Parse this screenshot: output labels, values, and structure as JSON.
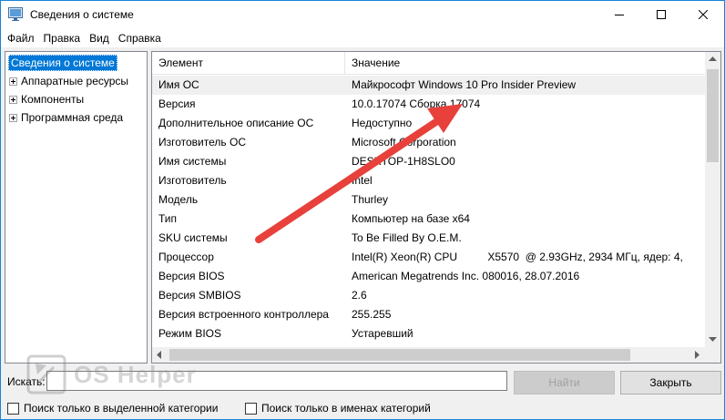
{
  "window": {
    "title": "Сведения о системе",
    "icon": "system-info-icon"
  },
  "menu": [
    "Файл",
    "Правка",
    "Вид",
    "Справка"
  ],
  "tree": {
    "root": "Сведения о системе",
    "children": [
      "Аппаратные ресурсы",
      "Компоненты",
      "Программная среда"
    ]
  },
  "table": {
    "columns": [
      "Элемент",
      "Значение"
    ],
    "rows": [
      [
        "Имя ОС",
        "Майкрософт Windows 10 Pro Insider Preview"
      ],
      [
        "Версия",
        "10.0.17074 Сборка 17074"
      ],
      [
        "Дополнительное описание ОС",
        "Недоступно"
      ],
      [
        "Изготовитель ОС",
        "Microsoft Corporation"
      ],
      [
        "Имя системы",
        "DESKTOP-1H8SLO0"
      ],
      [
        "Изготовитель",
        "Intel"
      ],
      [
        "Модель",
        "Thurley"
      ],
      [
        "Тип",
        "Компьютер на базе x64"
      ],
      [
        "SKU системы",
        "To Be Filled By O.E.M."
      ],
      [
        "Процессор",
        "Intel(R) Xeon(R) CPU          X5570  @ 2.93GHz, 2934 МГц, ядер: 4, "
      ],
      [
        "Версия BIOS",
        "American Megatrends Inc. 080016, 28.07.2016"
      ],
      [
        "Версия SMBIOS",
        "2.6"
      ],
      [
        "Версия встроенного контроллера",
        "255.255"
      ],
      [
        "Режим BIOS",
        "Устаревший"
      ]
    ]
  },
  "search": {
    "label": "Искать:",
    "value": "",
    "find_button": "Найти",
    "close_button": "Закрыть",
    "check_selected": "Поиск только в выделенной категории",
    "check_names": "Поиск только в именах категорий"
  },
  "watermark": "OS Helper",
  "colors": {
    "selection": "#0078d7",
    "annotation_arrow": "#e8403a"
  }
}
